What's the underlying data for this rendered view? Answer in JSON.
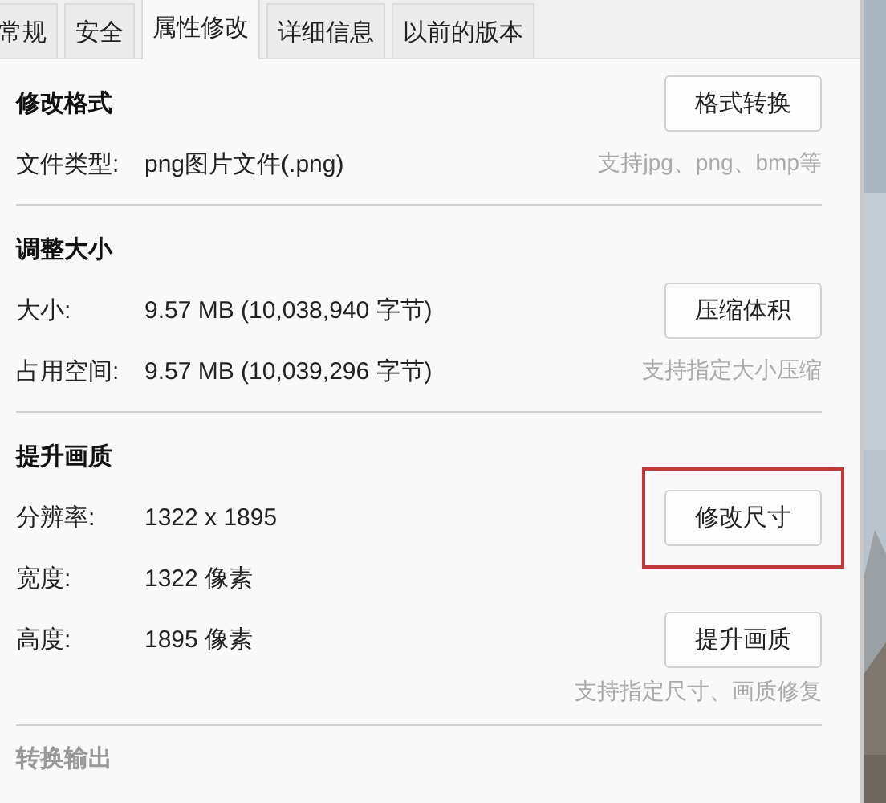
{
  "tabs": [
    {
      "label": "常规",
      "selected": false
    },
    {
      "label": "安全",
      "selected": false
    },
    {
      "label": "属性修改",
      "selected": true
    },
    {
      "label": "详细信息",
      "selected": false
    },
    {
      "label": "以前的版本",
      "selected": false
    }
  ],
  "sections": [
    {
      "title": "修改格式",
      "disabled": false,
      "title_button": {
        "label": "格式转换",
        "highlighted": false
      },
      "rows": [
        {
          "label": "文件类型:",
          "value": "png图片文件(.png)",
          "hint": "支持jpg、png、bmp等"
        }
      ]
    },
    {
      "title": "调整大小",
      "disabled": false,
      "rows": [
        {
          "label": "大小:",
          "value": "9.57 MB (10,038,940 字节)",
          "button": {
            "label": "压缩体积",
            "highlighted": false
          }
        },
        {
          "label": "占用空间:",
          "value": "9.57 MB (10,039,296 字节)",
          "hint": "支持指定大小压缩"
        }
      ]
    },
    {
      "title": "提升画质",
      "disabled": false,
      "rows": [
        {
          "label": "分辨率:",
          "value": "1322 x 1895",
          "button": {
            "label": "修改尺寸",
            "highlighted": true
          }
        },
        {
          "label": "宽度:",
          "value": "1322 像素"
        },
        {
          "label": "高度:",
          "value": "1895 像素",
          "button": {
            "label": "提升画质",
            "highlighted": false
          }
        }
      ],
      "hint": "支持指定尺寸、画质修复"
    },
    {
      "title": "转换输出",
      "disabled": true
    }
  ]
}
